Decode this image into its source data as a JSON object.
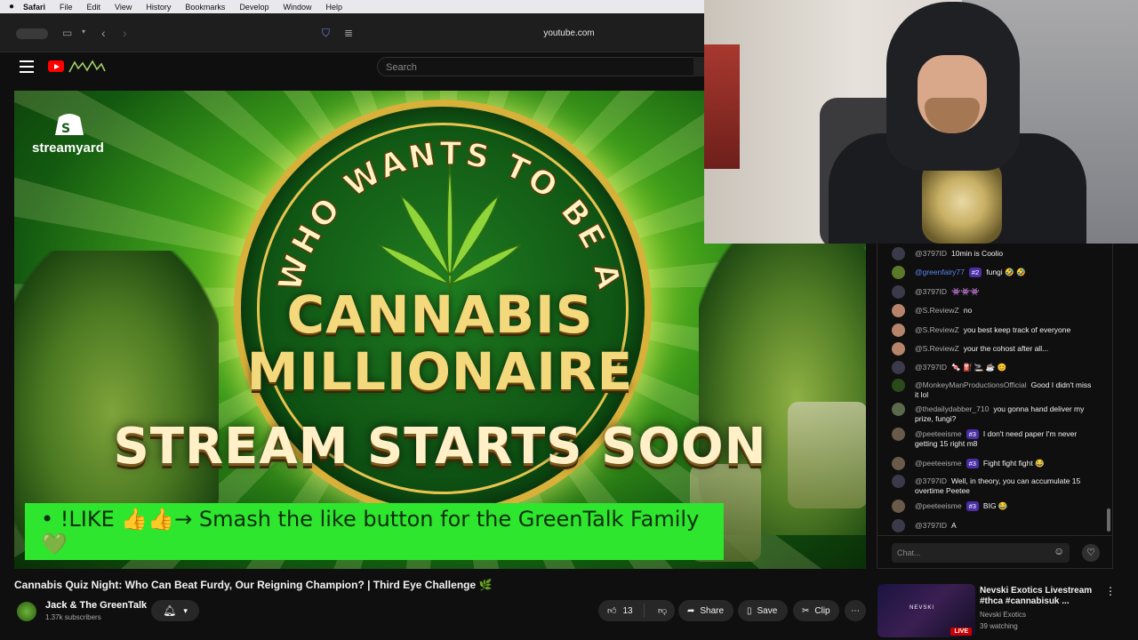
{
  "menubar": {
    "apple": "",
    "items": [
      "Safari",
      "File",
      "Edit",
      "View",
      "History",
      "Bookmarks",
      "Develop",
      "Window",
      "Help"
    ]
  },
  "browser": {
    "url": "youtube.com"
  },
  "youtube": {
    "search_placeholder": "Search"
  },
  "video": {
    "overlay_brand": "streamyard",
    "arc_title": "WHO WANTS TO BE A",
    "title_line1": "CANNABIS",
    "title_line2": "MILLIONAIRE",
    "title_line3": "STREAM STARTS SOON",
    "ticker": "• !LIKE 👍👍→ Smash the like button for the GreenTalk Family 💚",
    "title": "Cannabis Quiz Night: Who Can Beat Furdy, Our Reigning Champion? | Third Eye Challenge 🌿"
  },
  "channel": {
    "name": "Jack & The GreenTalk",
    "subscribers": "1.37k subscribers"
  },
  "actions": {
    "likes": "13",
    "share": "Share",
    "save": "Save",
    "clip": "Clip"
  },
  "chat": {
    "messages": [
      {
        "author": "@3797ID",
        "badge": "",
        "text": "10min is Coolio",
        "mod": false
      },
      {
        "author": "@greenfairy77",
        "badge": "#2",
        "text": "fungi 🤣 🤣",
        "mod": true
      },
      {
        "author": "@3797ID",
        "badge": "",
        "text": "👾👾👾",
        "mod": false
      },
      {
        "author": "@S.ReviewZ",
        "badge": "",
        "text": "no",
        "mod": false
      },
      {
        "author": "@S.ReviewZ",
        "badge": "",
        "text": "you best keep track of everyone",
        "mod": false
      },
      {
        "author": "@S.ReviewZ",
        "badge": "",
        "text": "your the cohost after all...",
        "mod": false
      },
      {
        "author": "@3797ID",
        "badge": "",
        "text": "🍬 ⛽ 🚬 ☕ 😊",
        "mod": false
      },
      {
        "author": "@MonkeyManProductionsOfficial",
        "badge": "",
        "text": "Good I didn't miss it lol",
        "mod": false
      },
      {
        "author": "@thedailydabber_710",
        "badge": "",
        "text": "you gonna hand deliver my prize, fungi?",
        "mod": false
      },
      {
        "author": "@peeteeisme",
        "badge": "#3",
        "text": "I don't need paper I'm never getting 15 right m8",
        "mod": false
      },
      {
        "author": "@peeteeisme",
        "badge": "#3",
        "text": "Fight fight fight 😂",
        "mod": false
      },
      {
        "author": "@3797ID",
        "badge": "",
        "text": "Well, in theory, you can accumulate 15 overtime Peetee",
        "mod": false
      },
      {
        "author": "@peeteeisme",
        "badge": "#3",
        "text": "BIG 😂",
        "mod": false
      },
      {
        "author": "@3797ID",
        "badge": "",
        "text": "A",
        "mod": false
      }
    ],
    "input_placeholder": "Chat..."
  },
  "recommended": {
    "title": "Nevski Exotics Livestream #thca #cannabisuk ...",
    "channel": "Nevski Exotics",
    "watching": "39 watching",
    "live": "LIVE",
    "thumb_label": "NEVSKI"
  },
  "colors": {
    "yt_red": "#ff0000",
    "ticker_green": "#2de62d",
    "gold": "#f4d97c",
    "mod_blue": "#5e84f1"
  }
}
